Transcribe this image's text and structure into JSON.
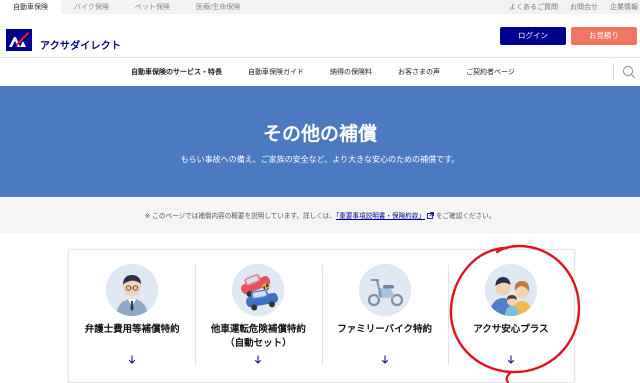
{
  "product_tabs": [
    {
      "label": "自動車保険",
      "active": true
    },
    {
      "label": "バイク保険",
      "active": false
    },
    {
      "label": "ペット保険",
      "active": false
    },
    {
      "label": "医療/生命保険",
      "active": false
    }
  ],
  "utility_links": [
    "よくあるご質問",
    "お問合せ",
    "企業情報"
  ],
  "header": {
    "brand": "アクサダイレクト",
    "login_label": "ログイン",
    "quote_label": "お見積り"
  },
  "nav": {
    "items": [
      "自動車保険のサービス・特長",
      "自動車保険ガイド",
      "納得の保険料",
      "お客さまの声",
      "ご契約者ページ"
    ],
    "current_index": 0
  },
  "hero": {
    "title": "その他の補償",
    "subtitle": "もらい事故への備え、ご家族の安全など、より大きな安心のための補償です。"
  },
  "note": {
    "prefix": "※ このページでは補償内容の概要を説明しています。詳しくは、",
    "link": "「重要事項説明書・保険約款」",
    "suffix": "をご確認ください。"
  },
  "cards": [
    {
      "line1": "弁護士費用等補償特約",
      "line2": ""
    },
    {
      "line1": "他車運転危険補償特約",
      "line2": "（自動セット）"
    },
    {
      "line1": "ファミリーバイク特約",
      "line2": ""
    },
    {
      "line1": "アクサ安心プラス",
      "line2": ""
    }
  ],
  "colors": {
    "brand_blue": "#00008f",
    "hero_blue": "#4c7ac0",
    "quote_coral": "#f07662",
    "annotation_red": "#e0141e"
  },
  "icons": [
    "axa-logo-icon",
    "search-icon",
    "external-link-icon",
    "down-arrow-icon"
  ]
}
